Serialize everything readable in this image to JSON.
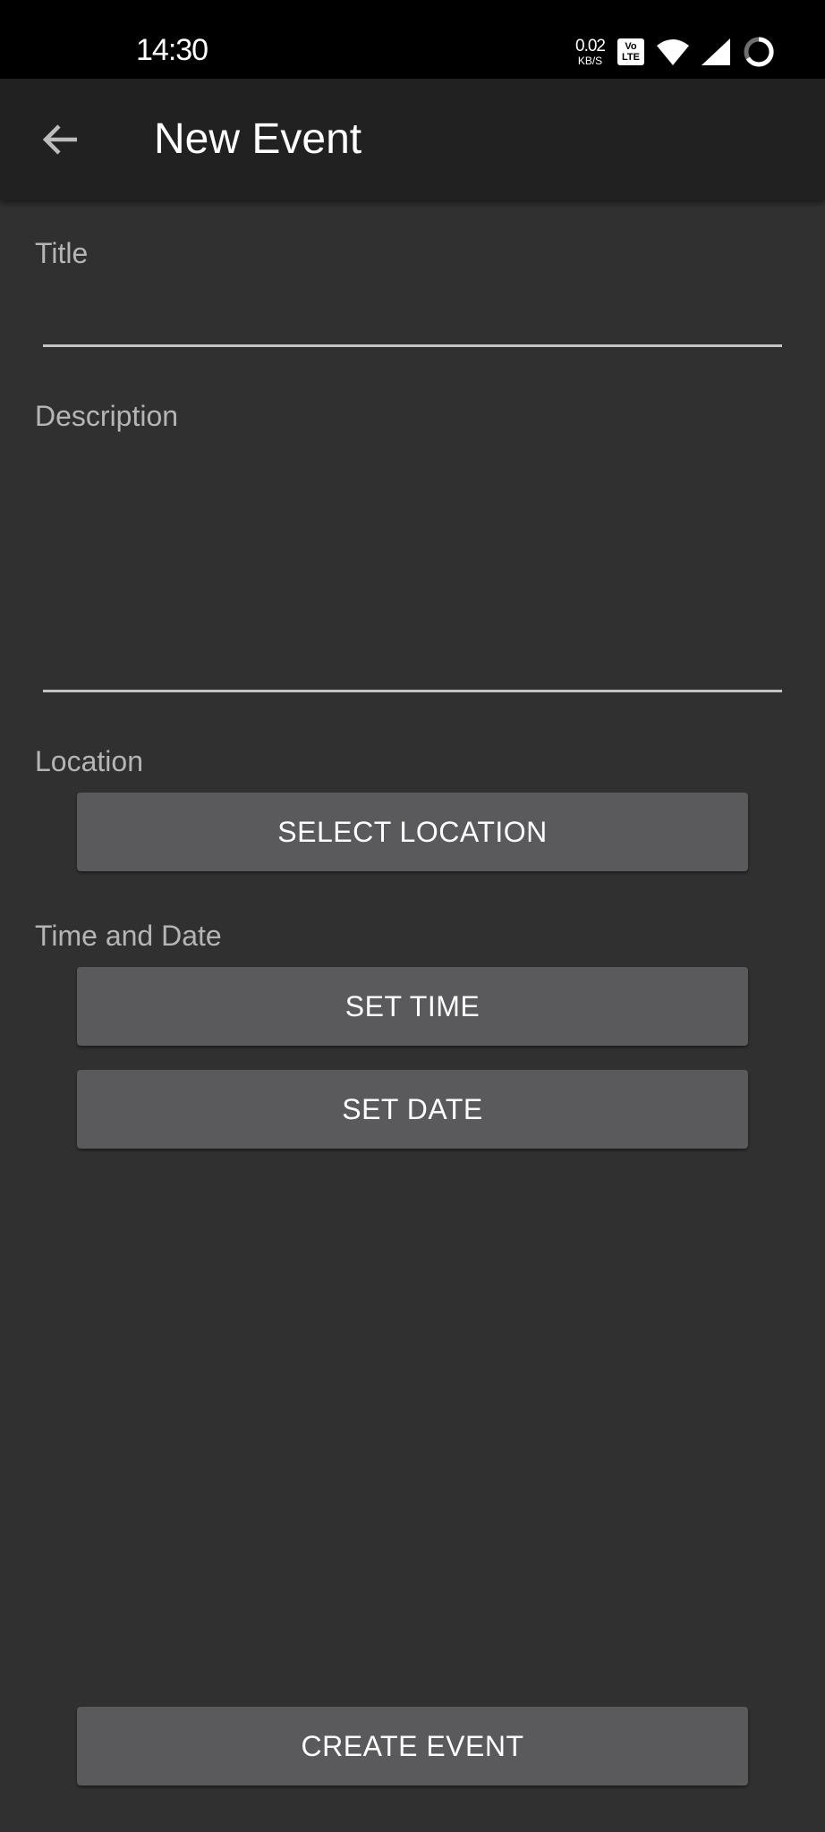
{
  "status_bar": {
    "time": "14:30",
    "net_speed_value": "0.02",
    "net_speed_unit": "KB/S",
    "volte_top": "Vo",
    "volte_bottom": "LTE"
  },
  "app_bar": {
    "title": "New Event",
    "back_icon": "arrow-back-icon"
  },
  "form": {
    "title_label": "Title",
    "title_value": "",
    "description_label": "Description",
    "description_value": "",
    "location_label": "Location",
    "select_location_button": "SELECT LOCATION",
    "time_date_label": "Time and Date",
    "set_time_button": "SET TIME",
    "set_date_button": "SET DATE",
    "create_event_button": "CREATE EVENT"
  },
  "colors": {
    "background": "#303030",
    "app_bar": "#212121",
    "button": "#5a5a5c",
    "label": "#b5b5b5",
    "underline": "#c4c4c4"
  }
}
